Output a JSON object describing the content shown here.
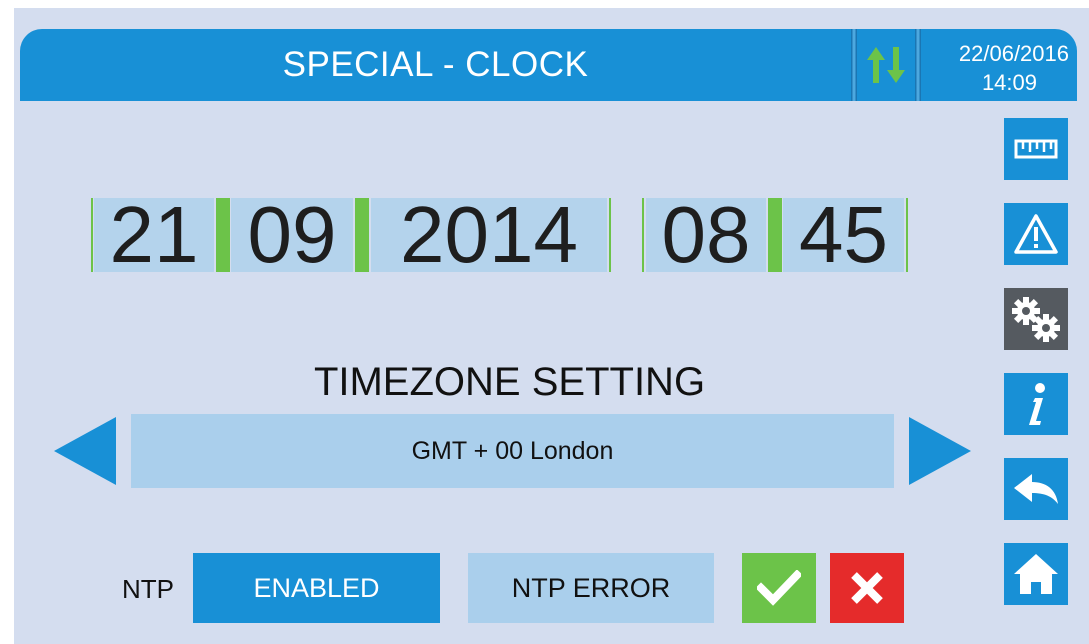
{
  "header": {
    "title": "SPECIAL - CLOCK",
    "date": "22/06/2016",
    "time": "14:09",
    "sync_icon": "sync-arrows-icon"
  },
  "clock": {
    "day": "21",
    "month": "09",
    "year": "2014",
    "hour": "08",
    "minute": "45"
  },
  "timezone": {
    "label": "TIMEZONE SETTING",
    "value": "GMT + 00 London"
  },
  "ntp": {
    "label": "NTP",
    "state": "ENABLED",
    "status": "NTP ERROR"
  },
  "sidebar": {
    "items": [
      {
        "icon": "ruler-icon"
      },
      {
        "icon": "warning-icon"
      },
      {
        "icon": "gears-icon"
      },
      {
        "icon": "info-icon"
      },
      {
        "icon": "back-icon"
      },
      {
        "icon": "home-icon"
      }
    ]
  },
  "colors": {
    "primary": "#1890d6",
    "panel": "#d4ddef",
    "field": "#b4d3ec",
    "accent_green": "#6cc349",
    "cancel_red": "#e52b2b",
    "active_gear": "#555a60"
  }
}
